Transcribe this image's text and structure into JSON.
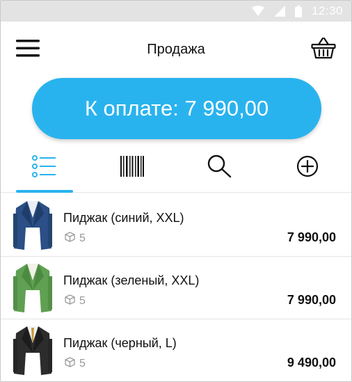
{
  "status_bar": {
    "time": "12:30"
  },
  "app_bar": {
    "title": "Продажа"
  },
  "pay_button": {
    "label": "К оплате: 7 990,00"
  },
  "tabs": [
    {
      "name": "list-icon",
      "active": true
    },
    {
      "name": "barcode-icon",
      "active": false
    },
    {
      "name": "search-icon",
      "active": false
    },
    {
      "name": "add-icon",
      "active": false
    }
  ],
  "products": [
    {
      "name": "Пиджак (синий, XXL)",
      "stock": "5",
      "price": "7 990,00",
      "color": "#2b4f86"
    },
    {
      "name": "Пиджак (зеленый, XXL)",
      "stock": "5",
      "price": "7 990,00",
      "color": "#5fa052"
    },
    {
      "name": "Пиджак (черный, L)",
      "stock": "5",
      "price": "9 490,00",
      "color": "#2c2c2c"
    }
  ],
  "colors": {
    "accent": "#29b3ee",
    "status_bar": "#e3e3e3"
  }
}
